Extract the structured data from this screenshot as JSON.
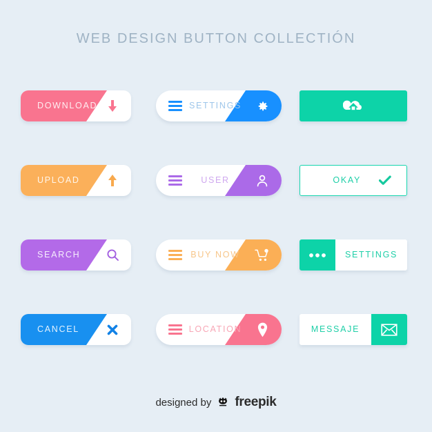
{
  "page": {
    "title": "WEB DESIGN BUTTON COLLECTIÓN",
    "background_color": "#e6eef5",
    "title_color": "#9fb3c4"
  },
  "buttons": [
    {
      "id": "download",
      "label": "DOWNLOAD",
      "style": "colored-body-white-wedge",
      "shape": "rounded",
      "color": "#f9748f",
      "icon": "arrow-down-icon",
      "icon_color": "#f9748f",
      "text_color": "#ffffff"
    },
    {
      "id": "settings-top",
      "label": "SETTINGS",
      "style": "white-body-colored-wedge",
      "shape": "pill",
      "color": "#1890ff",
      "icon": "gear-icon",
      "menu_icon": "hamburger-icon",
      "icon_color": "#ffffff",
      "text_color": "#9ec6ea"
    },
    {
      "id": "cloud-upload",
      "label": "",
      "style": "solid",
      "shape": "sharp",
      "color": "#0dd3a8",
      "icon": "cloud-upload-icon",
      "icon_color": "#ffffff",
      "text_color": "#ffffff"
    },
    {
      "id": "upload",
      "label": "UPLOAD",
      "style": "colored-body-white-wedge",
      "shape": "rounded",
      "color": "#fbb05a",
      "icon": "arrow-up-icon",
      "icon_color": "#f8a94d",
      "text_color": "#ffffff"
    },
    {
      "id": "user",
      "label": "USER",
      "style": "white-body-colored-wedge",
      "shape": "pill",
      "color": "#ab6ae8",
      "icon": "person-icon",
      "menu_icon": "hamburger-icon",
      "icon_color": "#ffffff",
      "text_color": "#cfa8ef"
    },
    {
      "id": "okay",
      "label": "OKAY",
      "style": "outline",
      "shape": "sharp",
      "color": "#16d6ae",
      "icon": "check-icon",
      "icon_color": "#16c99f",
      "text_color": "#1fcfa8"
    },
    {
      "id": "search",
      "label": "SEARCH",
      "style": "colored-body-white-wedge",
      "shape": "rounded",
      "color": "#b36ae8",
      "icon": "magnifier-icon",
      "icon_color": "#a25fe0",
      "text_color": "#ffffff"
    },
    {
      "id": "buy-now",
      "label": "BUY NOW",
      "style": "white-body-colored-wedge",
      "shape": "pill",
      "color": "#fbaf56",
      "icon": "shopping-cart-icon",
      "menu_icon": "hamburger-icon",
      "icon_color": "#ffffff",
      "text_color": "#f7c68a"
    },
    {
      "id": "settings-bottom",
      "label": "SETTINGS",
      "style": "split-left",
      "shape": "sharp",
      "color": "#0dd3a8",
      "icon": "three-dots-icon",
      "icon_color": "#ffffff",
      "text_color": "#1fcfa8"
    },
    {
      "id": "cancel",
      "label": "CANCEL",
      "style": "colored-body-white-wedge",
      "shape": "rounded",
      "color": "#1890f0",
      "icon": "close-x-icon",
      "icon_color": "#1282e6",
      "text_color": "#ffffff"
    },
    {
      "id": "location",
      "label": "LOCATION",
      "style": "white-body-colored-wedge",
      "shape": "pill",
      "color": "#f9748f",
      "icon": "map-pin-icon",
      "menu_icon": "hamburger-icon",
      "icon_color": "#ffffff",
      "text_color": "#f8a7b6"
    },
    {
      "id": "messaje",
      "label": "MESSAJE",
      "style": "split-right",
      "shape": "sharp",
      "color": "#0dd3a8",
      "icon": "envelope-icon",
      "icon_color": "#ffffff",
      "text_color": "#1fcfa8"
    }
  ],
  "footer": {
    "designed_by": "designed by",
    "brand": "freepik",
    "logo_icon": "freepik-logo-icon"
  }
}
